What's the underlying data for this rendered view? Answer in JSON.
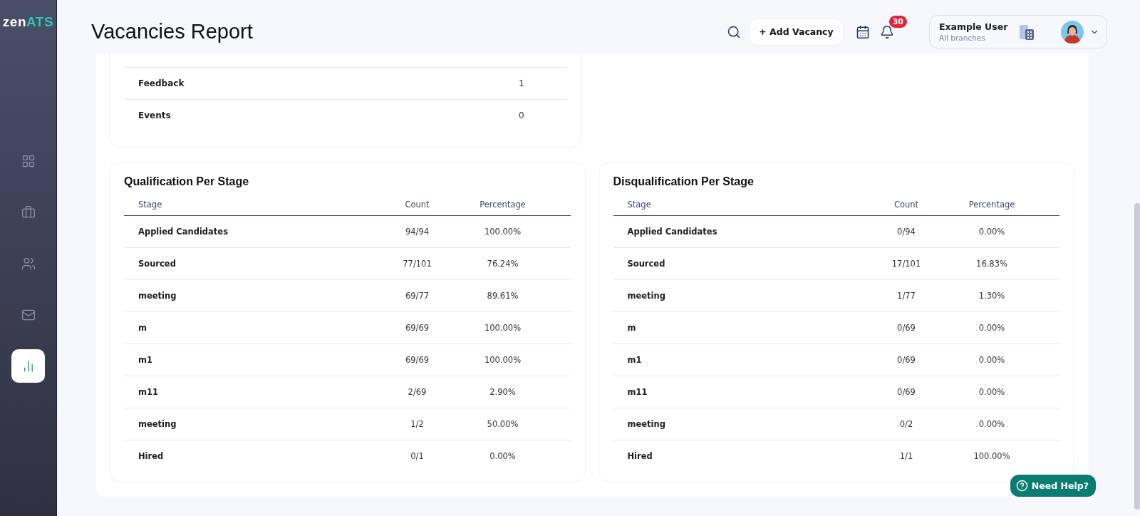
{
  "brand": {
    "logo_main": "zen",
    "logo_accent": "ATS"
  },
  "sidebar": {
    "items": [
      {
        "kind": "dashboard",
        "selected": false
      },
      {
        "kind": "jobs",
        "selected": false
      },
      {
        "kind": "people",
        "selected": false
      },
      {
        "kind": "mail",
        "selected": false
      },
      {
        "kind": "reports",
        "selected": true
      }
    ]
  },
  "header": {
    "title": "Vacancies Report",
    "add_button": "+ Add Vacancy",
    "notifications": "30",
    "user": {
      "name": "Example User",
      "subtitle": "All branches"
    }
  },
  "summary_card": {
    "rows": [
      {
        "label": "Feedback",
        "value": "1"
      },
      {
        "label": "Events",
        "value": "0"
      }
    ]
  },
  "stage_tables": [
    {
      "title": "Qualification Per Stage",
      "columns": [
        "Stage",
        "Count",
        "Percentage"
      ],
      "rows": [
        [
          "Applied Candidates",
          "94/94",
          "100.00%"
        ],
        [
          "Sourced",
          "77/101",
          "76.24%"
        ],
        [
          "meeting",
          "69/77",
          "89.61%"
        ],
        [
          "m",
          "69/69",
          "100.00%"
        ],
        [
          "m1",
          "69/69",
          "100.00%"
        ],
        [
          "m11",
          "2/69",
          "2.90%"
        ],
        [
          "meeting",
          "1/2",
          "50.00%"
        ],
        [
          "Hired",
          "0/1",
          "0.00%"
        ]
      ]
    },
    {
      "title": "Disqualification Per Stage",
      "columns": [
        "Stage",
        "Count",
        "Percentage"
      ],
      "rows": [
        [
          "Applied Candidates",
          "0/94",
          "0.00%"
        ],
        [
          "Sourced",
          "17/101",
          "16.83%"
        ],
        [
          "meeting",
          "1/77",
          "1.30%"
        ],
        [
          "m",
          "0/69",
          "0.00%"
        ],
        [
          "m1",
          "0/69",
          "0.00%"
        ],
        [
          "m11",
          "0/69",
          "0.00%"
        ],
        [
          "meeting",
          "0/2",
          "0.00%"
        ],
        [
          "Hired",
          "1/1",
          "100.00%"
        ]
      ]
    }
  ],
  "help_button": "Need Help?"
}
